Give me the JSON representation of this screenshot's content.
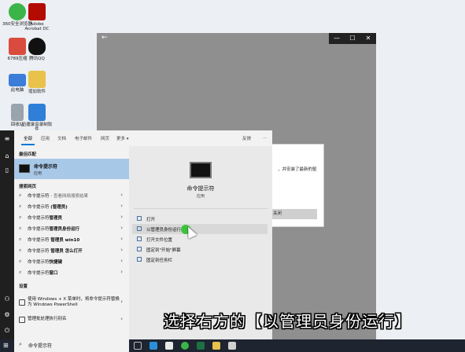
{
  "desktop_icons": [
    {
      "label": "360安全浏览器",
      "color": "#3bb54a"
    },
    {
      "label": "Adobe Acrobat DC",
      "color": "#b30b00"
    },
    {
      "label": "6789压缩",
      "color": "#d94c3d"
    },
    {
      "label": "腾讯QQ",
      "color": "#111111"
    },
    {
      "label": "此电脑",
      "color": "#3b7dd8"
    },
    {
      "label": "增加软件",
      "color": "#e8c24a"
    },
    {
      "label": "回收站",
      "color": "#9aa4ad"
    },
    {
      "label": "迅捷录音录制软件",
      "color": "#2f7fd8"
    }
  ],
  "app_window": {
    "back_label": "←",
    "minimize": "—",
    "maximize": "☐",
    "close": "✕"
  },
  "dialog": {
    "text": "，并安装了最新的驱",
    "button_label": "关闭"
  },
  "search_tabs": {
    "items": [
      "全部",
      "应用",
      "文档",
      "电子邮件",
      "网页",
      "更多 ▾"
    ],
    "active": "全部",
    "feedback": "反馈",
    "more_icon": "…"
  },
  "results": {
    "best_match_header": "最佳匹配",
    "best_match": {
      "title": "命令提示符",
      "subtitle": "应用"
    },
    "web_header": "搜索网页",
    "web_items": [
      {
        "main": "命令提示符",
        "sub": " - 查看网络搜索结果"
      },
      {
        "main": "命令提示符 ",
        "bold": "(管理员)"
      },
      {
        "main": "命令提示符",
        "bold": "管理员"
      },
      {
        "main": "命令提示符",
        "bold": "管理员身份运行"
      },
      {
        "main": "命令提示符 ",
        "bold": "管理员 win10"
      },
      {
        "main": "命令提示符 ",
        "bold": "管理员 怎么打开"
      },
      {
        "main": "命令提示符",
        "bold": "快捷键"
      },
      {
        "main": "命令提示符",
        "bold": "窗口"
      }
    ],
    "settings_header": "设置",
    "settings_items": [
      {
        "label": "使用 Windows + X 菜单时，将命令提示符替换为 Windows PowerShell"
      },
      {
        "label": "管理批处理执行别名"
      }
    ]
  },
  "preview": {
    "title": "命令提示符",
    "kind": "应用",
    "actions": [
      "打开",
      "以管理员身份运行",
      "打开文件位置",
      "固定到\"开始\"屏幕",
      "固定到任务栏"
    ]
  },
  "taskbar": {
    "search_value": "命令提示符"
  },
  "caption": "选择右方的【以管理员身份运行】",
  "colors": {
    "accent": "#0078d7",
    "best_match_bg": "#a8c8e8",
    "cursor_dot": "#3cc43c"
  }
}
